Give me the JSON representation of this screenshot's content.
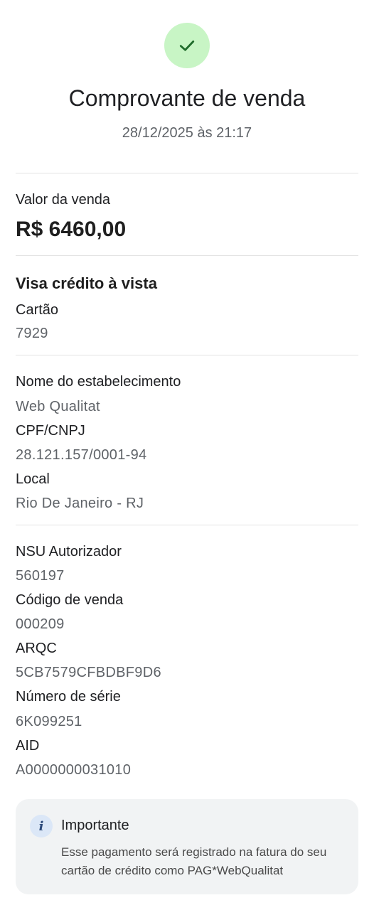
{
  "header": {
    "title": "Comprovante de venda",
    "datetime": "28/12/2025 às 21:17"
  },
  "sale": {
    "label": "Valor da venda",
    "amount": "R$ 6460,00"
  },
  "card": {
    "type": "Visa crédito à vista",
    "card_label": "Cartão",
    "card_number": "7929"
  },
  "merchant": {
    "name_label": "Nome do estabelecimento",
    "name": "Web Qualitat",
    "doc_label": "CPF/CNPJ",
    "doc": "28.121.157/0001-94",
    "location_label": "Local",
    "location": "Rio De Janeiro - RJ"
  },
  "transaction": {
    "nsu_label": "NSU Autorizador",
    "nsu": "560197",
    "sale_code_label": "Código de venda",
    "sale_code": "000209",
    "arqc_label": "ARQC",
    "arqc": "5CB7579CFBDBF9D6",
    "serial_label": "Número de série",
    "serial": "6K099251",
    "aid_label": "AID",
    "aid": "A0000000031010"
  },
  "notice": {
    "title": "Importante",
    "line1": "Esse pagamento será registrado na fatura do seu",
    "line2": "cartão de crédito como PAG*WebQualitat",
    "icon": "info-icon"
  },
  "colors": {
    "success_bg": "#c8f5c5",
    "success_check": "#1e6b2a",
    "notice_bg": "#f1f3f4"
  }
}
